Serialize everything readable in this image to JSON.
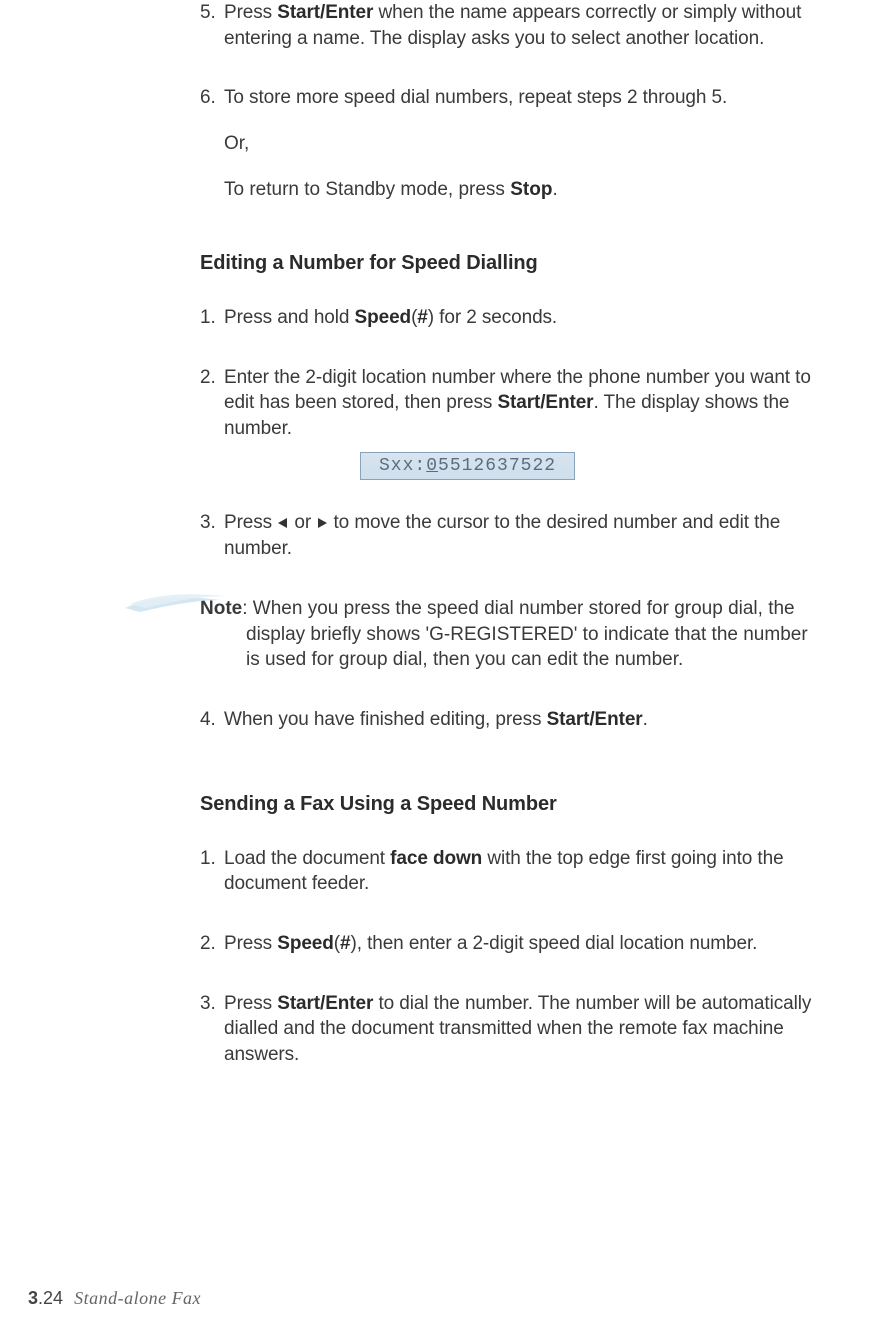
{
  "body": {
    "step5": {
      "num": "5.",
      "text_a": "Press ",
      "bold_a": "Start/Enter",
      "text_b": " when the name appears correctly or simply without entering a name. The display asks you to select another location."
    },
    "step6": {
      "num": "6.",
      "line1": "To store more speed dial numbers, repeat steps 2 through 5.",
      "or": "Or,",
      "line2_a": "To return to Standby mode, press ",
      "line2_bold": "Stop",
      "line2_b": "."
    },
    "heading_edit": "Editing a Number for Speed Dialling",
    "edit_step1": {
      "num": "1.",
      "text_a": "Press and hold ",
      "bold_a": "Speed",
      "text_b": "(",
      "bold_b": "#",
      "text_c": ") for 2 seconds."
    },
    "edit_step2": {
      "num": "2.",
      "text_a": "Enter the 2-digit location number where the phone number you want to edit has been stored, then press ",
      "bold_a": "Start/Enter",
      "text_b": ". The display shows the number."
    },
    "display": {
      "prefix": "Sxx:",
      "first": "0",
      "rest": "5512637522"
    },
    "edit_step3": {
      "num": "3.",
      "text_a": "Press ",
      "text_b": " or ",
      "text_c": " to move the cursor to the desired number and edit the number."
    },
    "note": {
      "label": "Note",
      "colon": ": ",
      "text": "When you press the speed dial number stored for group dial, the display briefly shows 'G-REGISTERED' to indicate that the number is used for group dial, then you can edit the number."
    },
    "edit_step4": {
      "num": "4.",
      "text_a": "When you have finished editing, press ",
      "bold_a": "Start/Enter",
      "text_b": "."
    },
    "heading_send": "Sending a Fax Using a Speed Number",
    "send_step1": {
      "num": "1.",
      "text_a": "Load the document ",
      "bold_a": "face down",
      "text_b": " with the top edge first going into the document feeder."
    },
    "send_step2": {
      "num": "2.",
      "text_a": "Press ",
      "bold_a": "Speed",
      "text_b": "(",
      "bold_b": "#",
      "text_c": "), then enter a 2-digit speed dial location number."
    },
    "send_step3": {
      "num": "3.",
      "text_a": "Press ",
      "bold_a": "Start/Enter",
      "text_b": " to dial the number. The number will be automatically dialled and the document transmitted when the remote fax machine answers."
    }
  },
  "footer": {
    "chapter": "3",
    "dot": ".",
    "page": "24",
    "section": "Stand-alone Fax"
  }
}
